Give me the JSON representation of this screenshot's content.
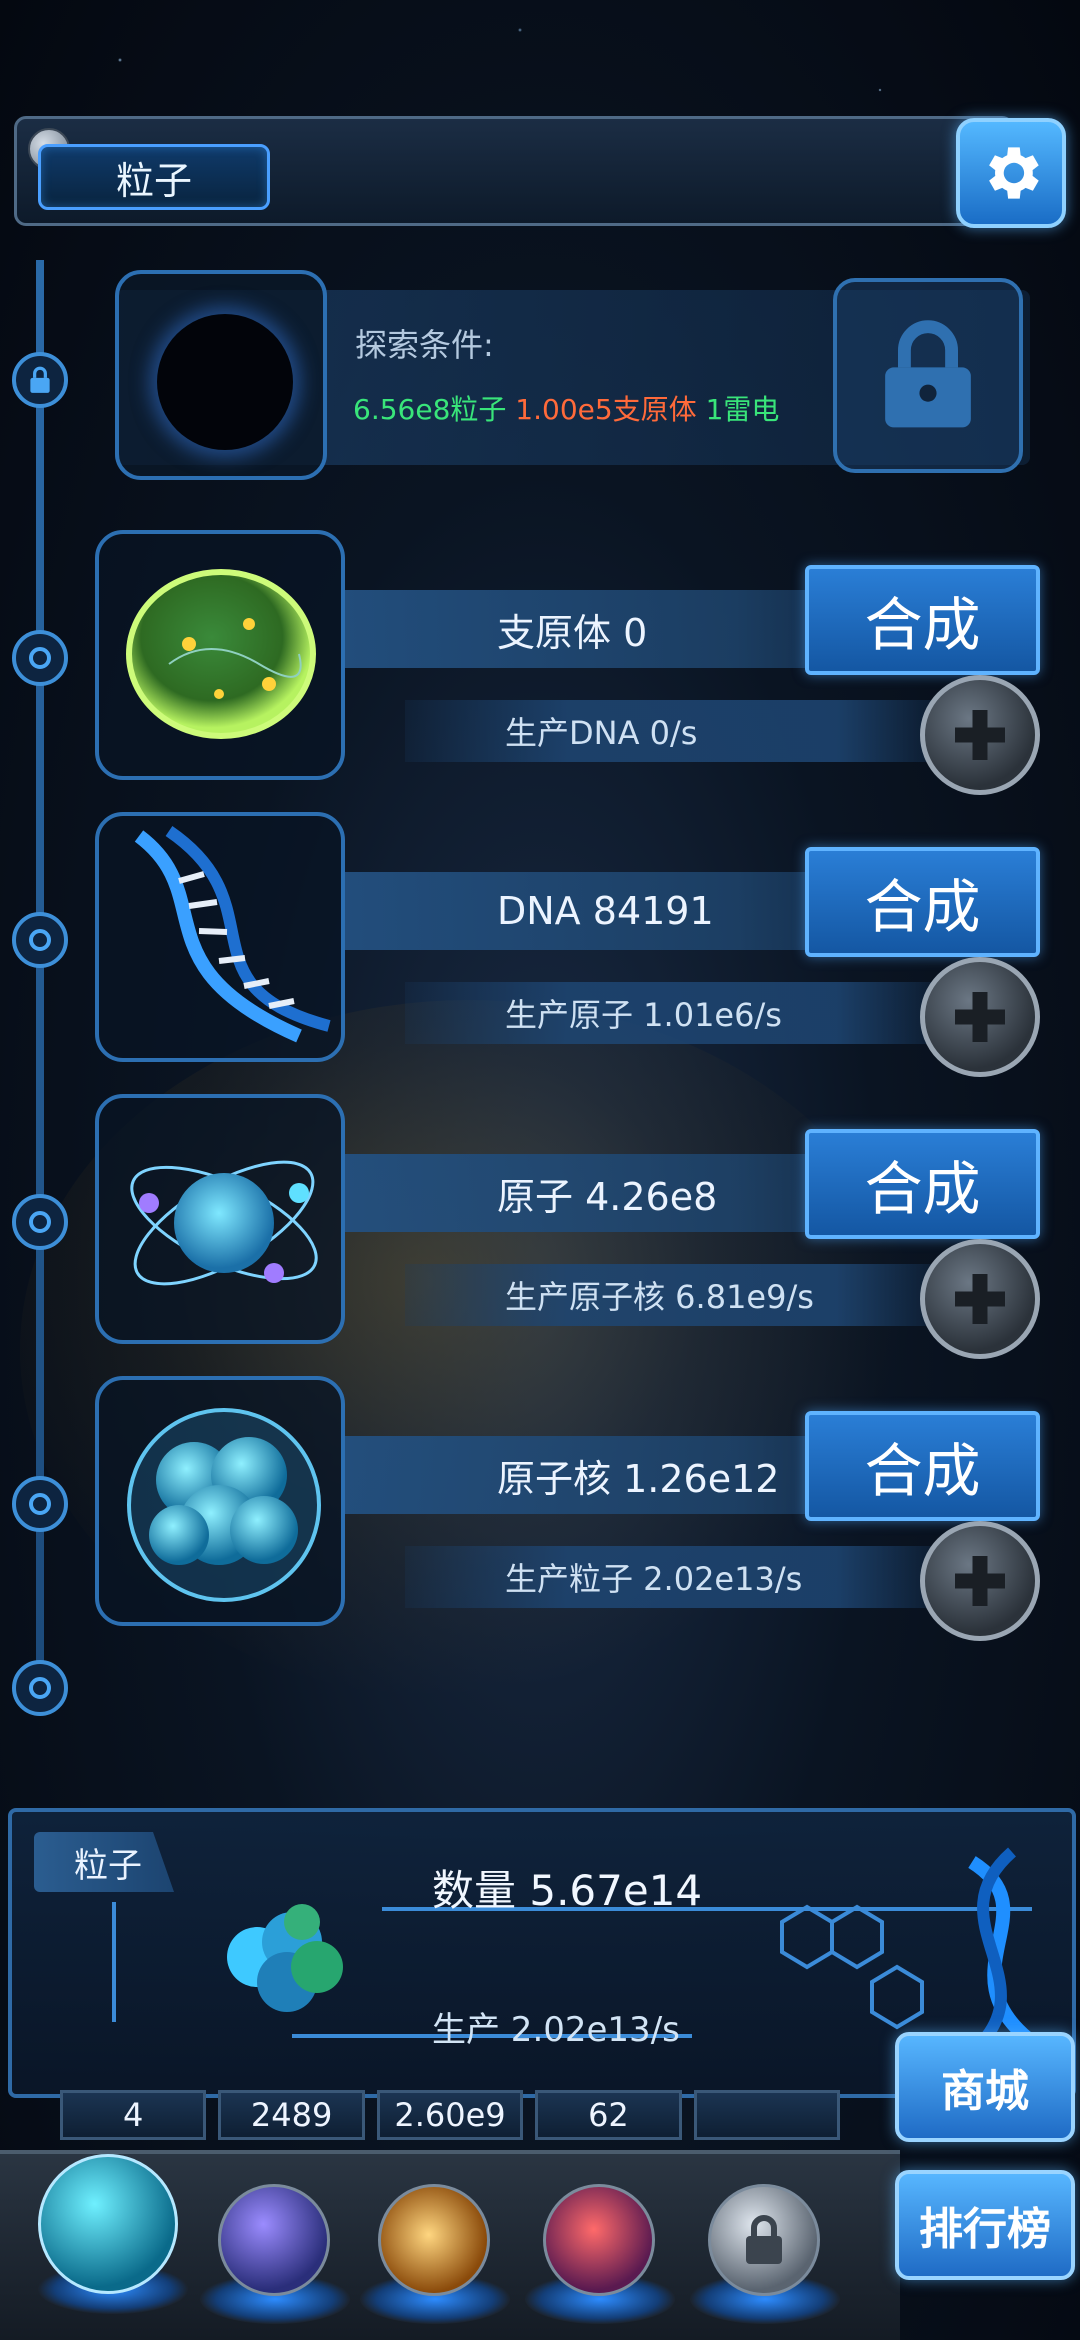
{
  "header": {
    "title": "粒子"
  },
  "explore": {
    "label": "探索条件:",
    "conditions": [
      {
        "text": "6.56e8粒子",
        "color": "green"
      },
      {
        "text": "1.00e5支原体",
        "color": "orange"
      },
      {
        "text": "1雷电",
        "color": "green"
      }
    ]
  },
  "rows": [
    {
      "name": "支原体 0",
      "produce": "生产DNA 0/s",
      "button": "合成",
      "icon": "cell-icon"
    },
    {
      "name": "DNA 84191",
      "produce": "生产原子 1.01e6/s",
      "button": "合成",
      "icon": "dna-helix-icon"
    },
    {
      "name": "原子 4.26e8",
      "produce": "生产原子核 6.81e9/s",
      "button": "合成",
      "icon": "atom-icon"
    },
    {
      "name": "原子核 1.26e12",
      "produce": "生产粒子 2.02e13/s",
      "button": "合成",
      "icon": "nucleus-icon"
    }
  ],
  "particle_panel": {
    "tag": "粒子",
    "count": "数量 5.67e14",
    "production": "生产 2.02e13/s"
  },
  "resources": [
    "4",
    "2489",
    "2.60e9",
    "62",
    ""
  ],
  "side_buttons": {
    "shop": "商城",
    "ranking": "排行榜"
  },
  "colors": {
    "accent": "#2a7ed6",
    "green": "#39e57a",
    "orange": "#ff6a3a"
  }
}
